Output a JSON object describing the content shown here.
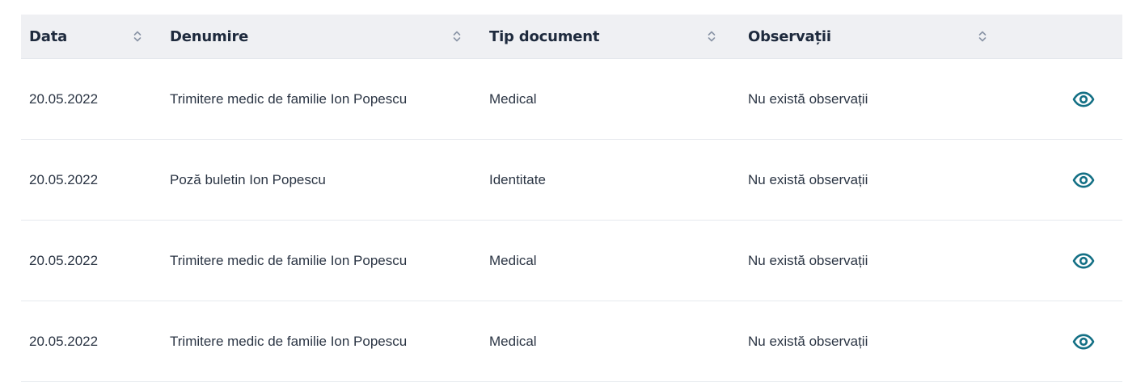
{
  "table": {
    "columns": [
      {
        "label": "Data",
        "sortable": true
      },
      {
        "label": "Denumire",
        "sortable": true
      },
      {
        "label": "Tip document",
        "sortable": true
      },
      {
        "label": "Observații",
        "sortable": true
      },
      {
        "label": "",
        "sortable": false
      }
    ],
    "rows": [
      {
        "data": "20.05.2022",
        "denumire": "Trimitere medic de familie Ion Popescu",
        "tip": "Medical",
        "observatii": "Nu există observații",
        "action_icon": "eye-icon"
      },
      {
        "data": "20.05.2022",
        "denumire": "Poză buletin Ion Popescu",
        "tip": "Identitate",
        "observatii": "Nu există observații",
        "action_icon": "eye-icon"
      },
      {
        "data": "20.05.2022",
        "denumire": "Trimitere medic de familie Ion Popescu",
        "tip": "Medical",
        "observatii": "Nu există observații",
        "action_icon": "eye-icon"
      },
      {
        "data": "20.05.2022",
        "denumire": "Trimitere medic de familie Ion Popescu",
        "tip": "Medical",
        "observatii": "Nu există observații",
        "action_icon": "eye-icon"
      }
    ]
  },
  "colors": {
    "header_bg": "#eff0f3",
    "accent": "#147085",
    "sort_icon": "#8a94a6",
    "row_divider": "#e6e9ee"
  }
}
